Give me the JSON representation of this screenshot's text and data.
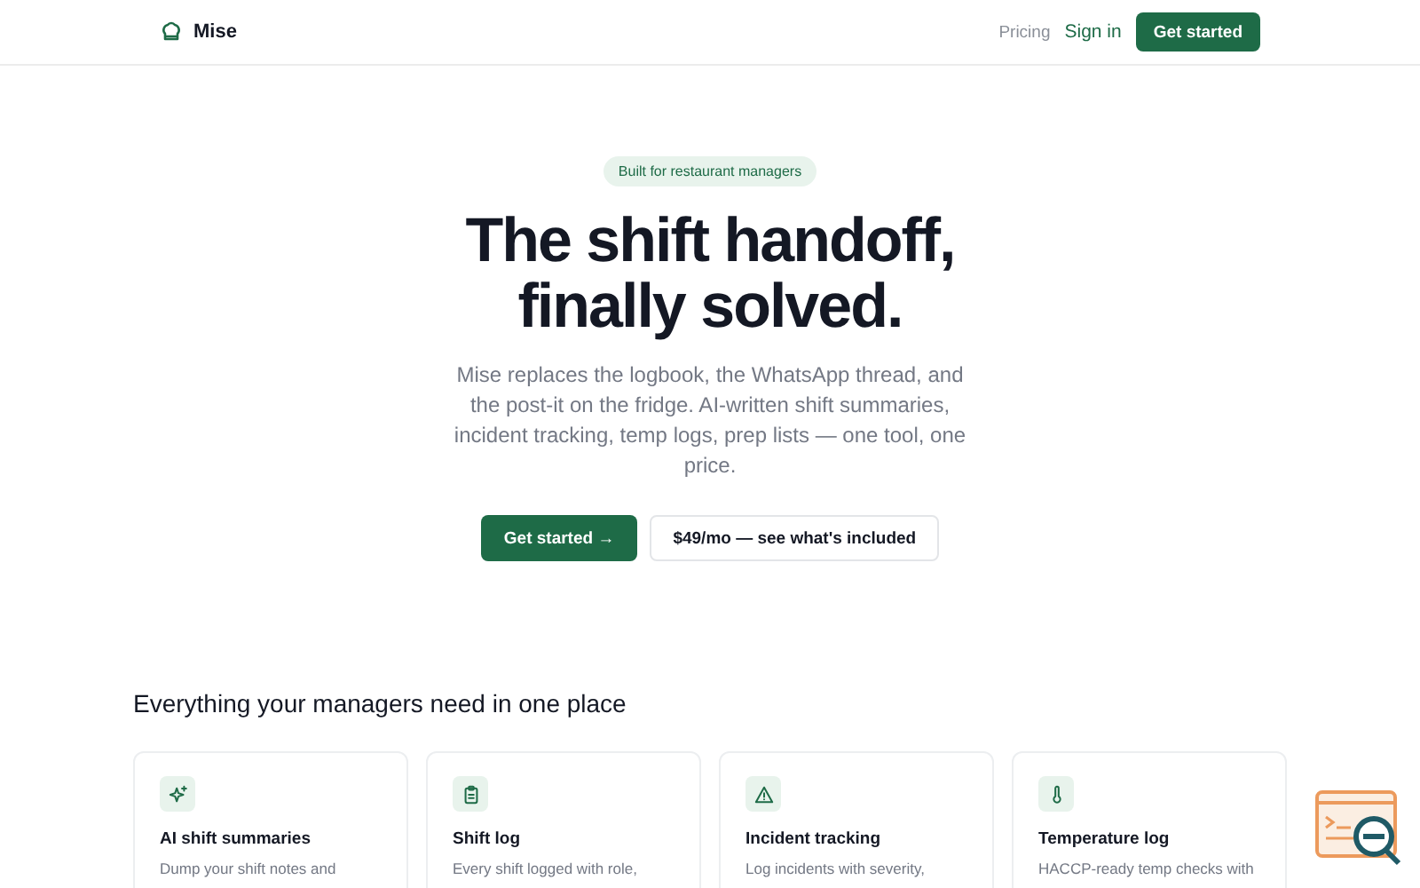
{
  "nav": {
    "brand": "Mise",
    "links": [
      "Pricing",
      "Sign in"
    ],
    "cta": "Get started"
  },
  "hero": {
    "badge": "Built for restaurant managers",
    "title_lines": [
      "The shift handoff,",
      "finally solved."
    ],
    "description": "Mise replaces the logbook, the WhatsApp thread, and the post-it on the fridge. AI-written shift summaries, incident tracking, temp logs, prep lists — one tool, one price.",
    "primary_button": "Get started",
    "primary_arrow": "→",
    "secondary_button": "$49/mo — see what's included"
  },
  "features": {
    "heading": "Everything your managers need in one place",
    "cards": [
      {
        "kind": "sparkles",
        "title": "AI shift summaries",
        "description": "Dump your shift notes and"
      },
      {
        "kind": "clipboard",
        "title": "Shift log",
        "description": "Every shift logged with role,"
      },
      {
        "kind": "warning",
        "title": "Incident tracking",
        "description": "Log incidents with severity,"
      },
      {
        "kind": "thermometer",
        "title": "Temperature log",
        "description": "HACCP-ready temp checks with"
      }
    ]
  }
}
